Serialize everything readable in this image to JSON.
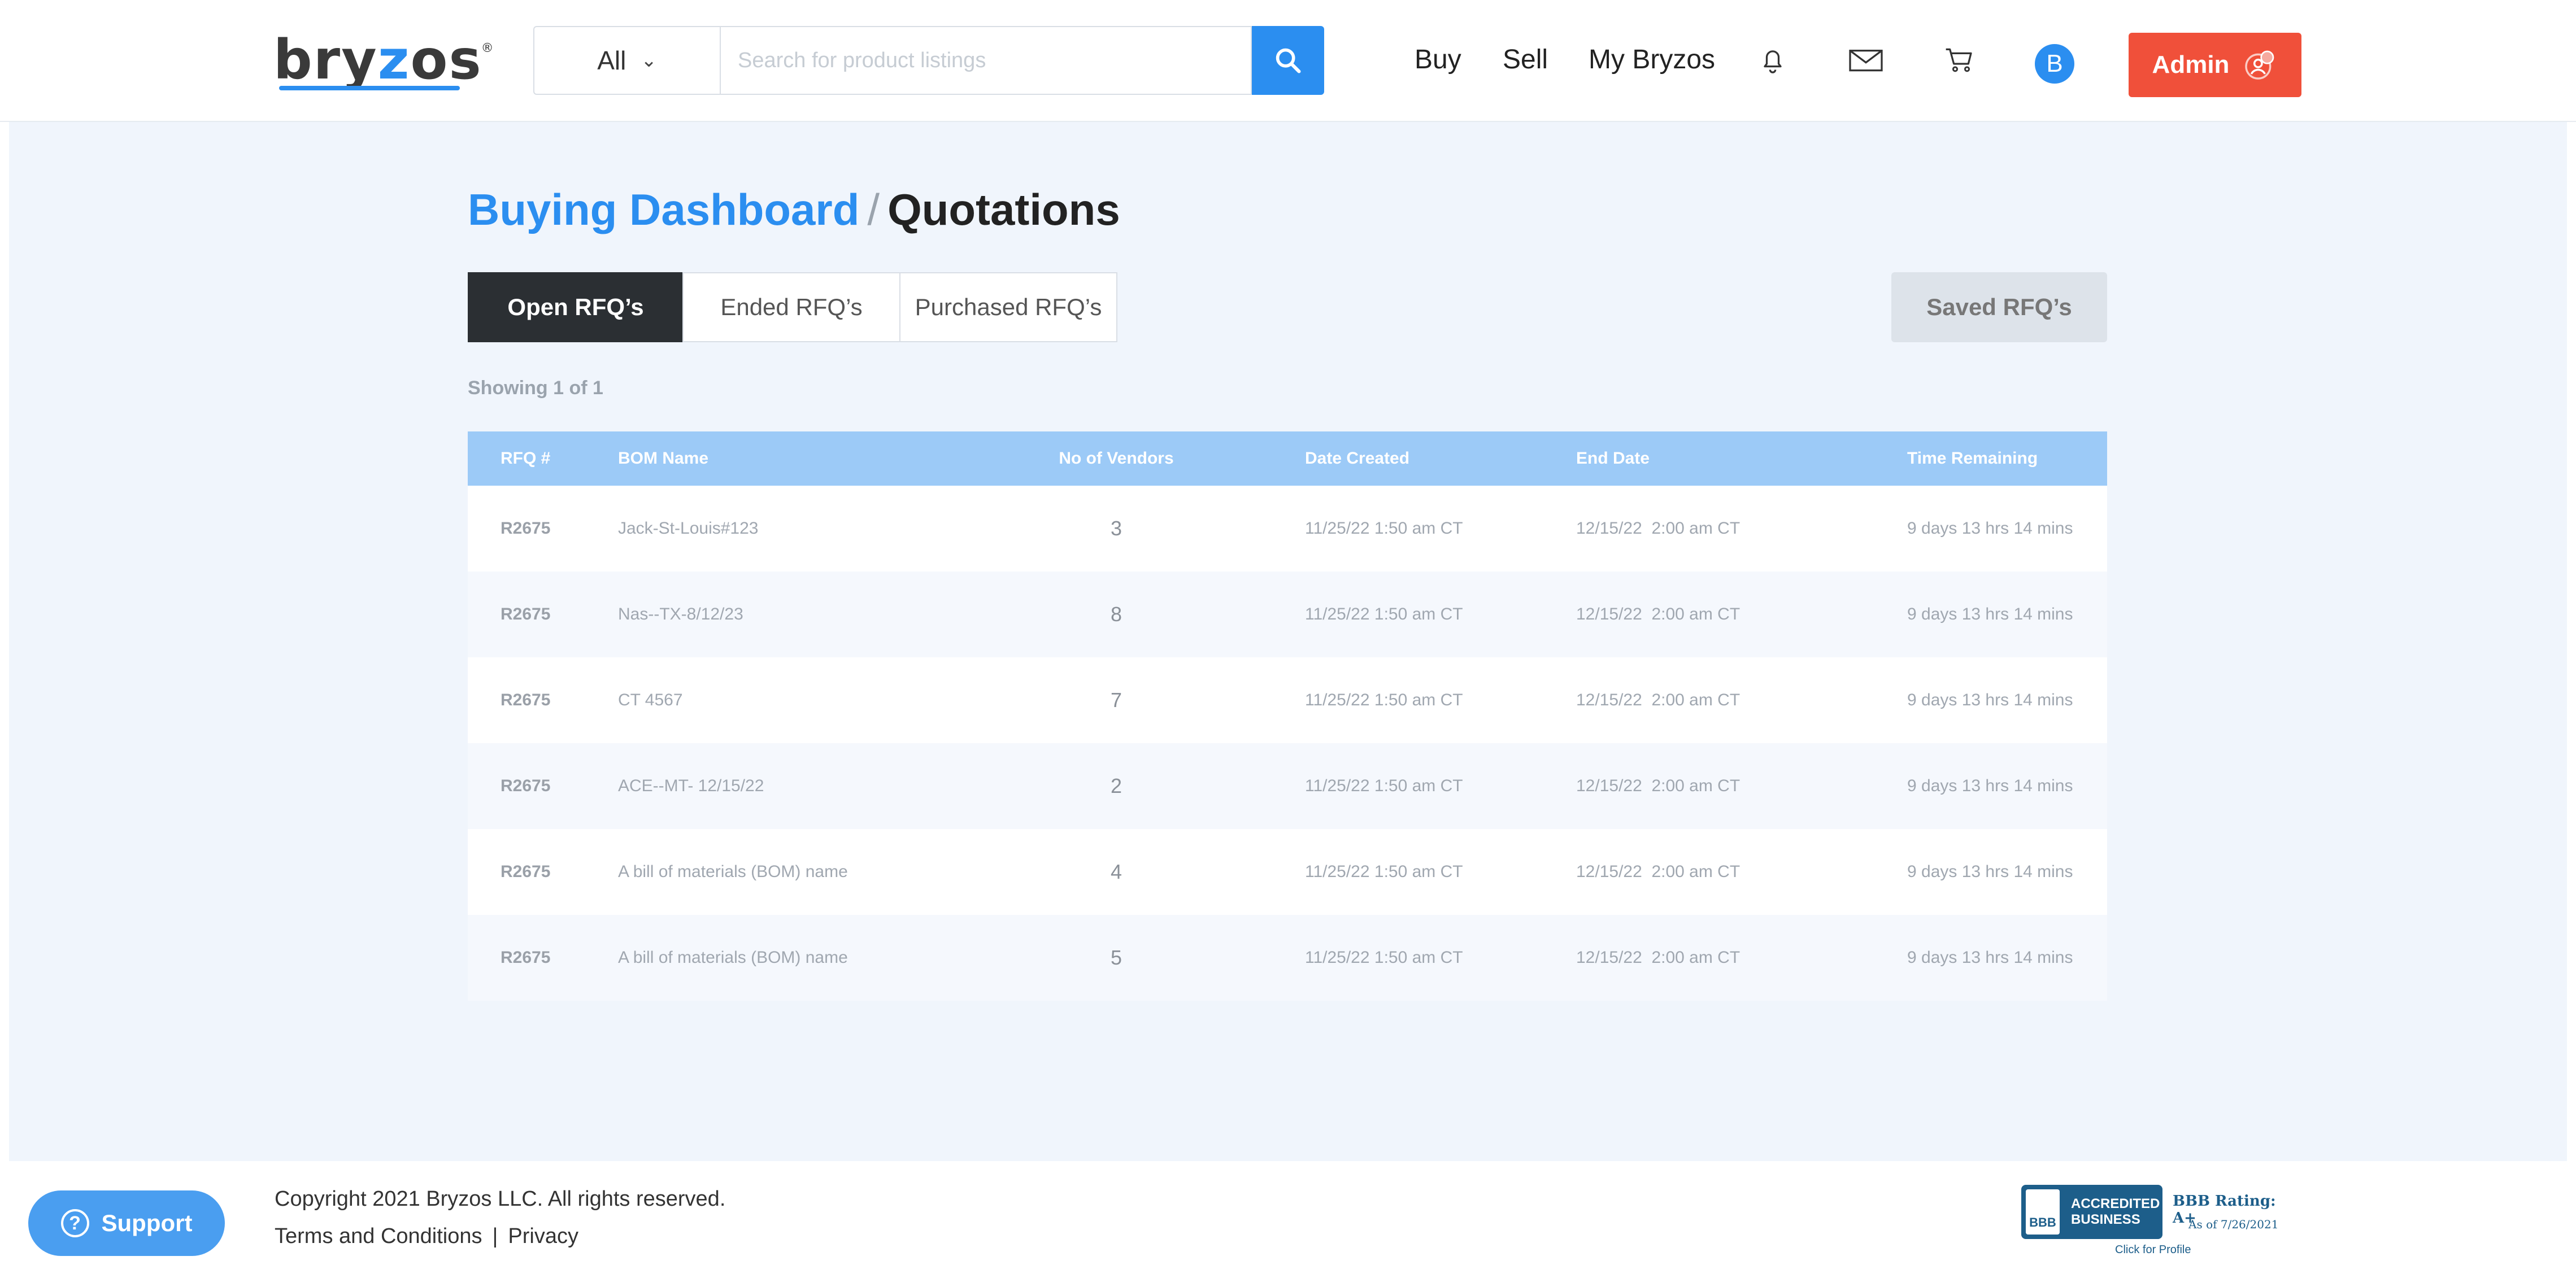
{
  "header": {
    "logo_text": "bryzos",
    "category_select": "All",
    "search_placeholder": "Search for product listings",
    "nav": {
      "buy": "Buy",
      "sell": "Sell",
      "my_bryzos": "My Bryzos"
    },
    "icons": [
      "bell-icon",
      "mail-icon",
      "cart-icon"
    ],
    "avatar_initial": "B",
    "admin_label": "Admin",
    "accent_color": "#2b8ef0",
    "admin_color": "#f0503a"
  },
  "page": {
    "breadcrumb_link": "Buying Dashboard",
    "breadcrumb_sep": "/",
    "breadcrumb_current": "Quotations",
    "tabs": [
      {
        "label": "Open RFQ’s",
        "active": true
      },
      {
        "label": "Ended RFQ’s",
        "active": false
      },
      {
        "label": "Purchased RFQ’s",
        "active": false
      }
    ],
    "saved_label": "Saved RFQ’s",
    "showing": "Showing 1 of 1"
  },
  "table": {
    "columns": [
      "RFQ #",
      "BOM Name",
      "No of Vendors",
      "Date Created",
      "End Date",
      "Time Remaining"
    ],
    "rows": [
      {
        "rfq": "R2675",
        "bom": "Jack-St-Louis#123",
        "vendors": "3",
        "created": "11/25/22 1:50 am CT",
        "end": "12/15/22  2:00 am CT",
        "remaining": "9 days 13 hrs 14 mins"
      },
      {
        "rfq": "R2675",
        "bom": "Nas--TX-8/12/23",
        "vendors": "8",
        "created": "11/25/22 1:50 am CT",
        "end": "12/15/22  2:00 am CT",
        "remaining": "9 days 13 hrs 14 mins"
      },
      {
        "rfq": "R2675",
        "bom": "CT 4567",
        "vendors": "7",
        "created": "11/25/22 1:50 am CT",
        "end": "12/15/22  2:00 am CT",
        "remaining": "9 days 13 hrs 14 mins"
      },
      {
        "rfq": "R2675",
        "bom": "ACE--MT- 12/15/22",
        "vendors": "2",
        "created": "11/25/22 1:50 am CT",
        "end": "12/15/22  2:00 am CT",
        "remaining": "9 days 13 hrs 14 mins"
      },
      {
        "rfq": "R2675",
        "bom": "A bill of materials (BOM) name",
        "vendors": "4",
        "created": "11/25/22 1:50 am CT",
        "end": "12/15/22  2:00 am CT",
        "remaining": "9 days 13 hrs 14 mins"
      },
      {
        "rfq": "R2675",
        "bom": "A bill of materials (BOM) name",
        "vendors": "5",
        "created": "11/25/22 1:50 am CT",
        "end": "12/15/22  2:00 am CT",
        "remaining": "9 days 13 hrs 14 mins"
      }
    ]
  },
  "footer": {
    "support_label": "Support",
    "copyright": "Copyright 2021 Bryzos LLC. All rights reserved.",
    "terms": "Terms and Conditions",
    "pipe": "|",
    "privacy": "Privacy",
    "bbb": {
      "seal_line1": "ACCREDITED",
      "seal_line2": "BUSINESS",
      "seal_logo": "BBB",
      "rating": "BBB Rating: A+",
      "as_of": "As of 7/26/2021",
      "click": "Click for Profile"
    }
  }
}
